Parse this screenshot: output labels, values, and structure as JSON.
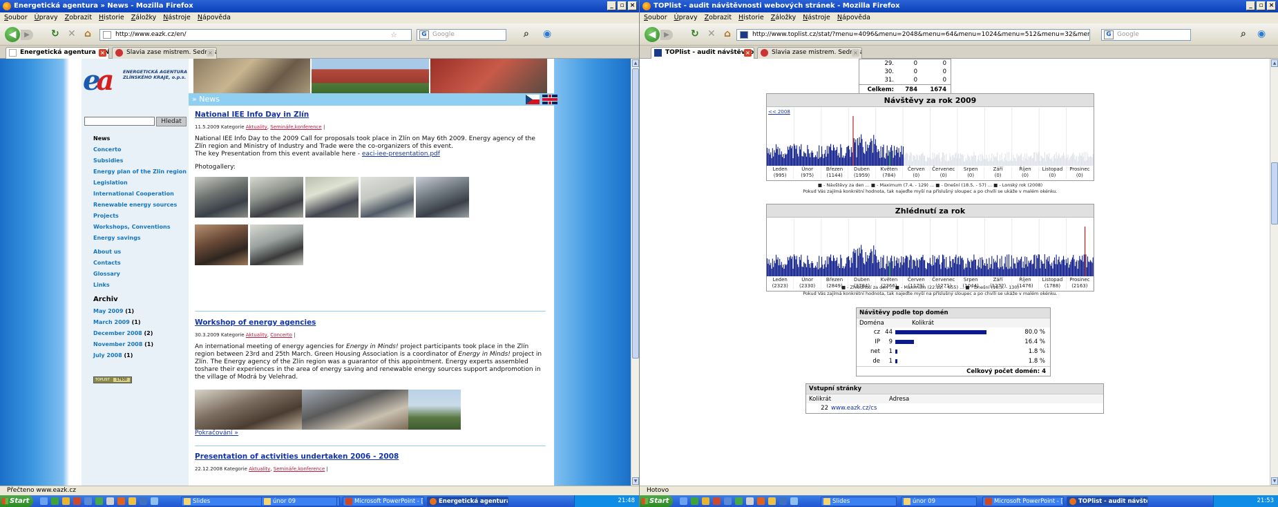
{
  "left_window": {
    "title": "Energetická agentura » News - Mozilla Firefox",
    "menu": [
      "Soubor",
      "Úpravy",
      "Zobrazit",
      "Historie",
      "Záložky",
      "Nástroje",
      "Nápověda"
    ],
    "url": "http://www.eazk.cz/en/",
    "search_placeholder": "Google",
    "tabs": [
      {
        "label": "Energetická agentura » News",
        "active": true
      },
      {
        "label": "Slavia zase mistrem. Sedmnáctý titul sl...",
        "active": false
      }
    ],
    "status": "Přečteno www.eazk.cz",
    "page": {
      "logo_text_1": "ENERGETICKÁ AGENTURA",
      "logo_text_2": "ZLÍNSKÉHO KRAJE, o.p.s.",
      "search_button": "Hledat",
      "news_bar": "» News",
      "nav": [
        "News",
        "Concerto",
        "Subsidies",
        "Energy plan of the Zlin region",
        "Legislation",
        "International Cooperation",
        "Renewable energy sources",
        "Projects",
        "Workshops, Conventions",
        "Energy savings"
      ],
      "nav2": [
        "About us",
        "Contacts",
        "Glossary",
        "Links"
      ],
      "archive_heading": "Archiv",
      "archive": [
        {
          "label": "May 2009",
          "count": "(1)"
        },
        {
          "label": "March 2009",
          "count": "(1)"
        },
        {
          "label": "December 2008",
          "count": "(2)"
        },
        {
          "label": "November 2008",
          "count": "(1)"
        },
        {
          "label": "July 2008",
          "count": "(1)"
        }
      ],
      "toplist_label": "TOPLIST",
      "toplist_count": "17930",
      "articles": [
        {
          "title": "National IEE Info Day in Zlín",
          "date_cat": "11.5.2009 Kategorie",
          "cats": [
            "Aktuality",
            "Semináře,konference"
          ],
          "body1": "National IEE Info Day to the 2009 Call for proposals took place in Zlín on May 6th 2009. Energy agency of the Zlín region and Ministry of Industry and Trade were the co-organizers of this event.",
          "body2": "The key Presentation from this event available here - ",
          "link": "eaci-iee-presentation.pdf",
          "gallery": "Photogallery:"
        },
        {
          "title": "Workshop of energy agencies",
          "date_cat": "30.3.2009 Kategorie",
          "cats": [
            "Aktuality",
            "Concerto"
          ],
          "body_pre": "An international meeting of energy agencies for ",
          "body_em1": "Energy in Minds!",
          "body_mid": " project participants took place in the Zlín region between 23rd and 25th March. Green Housing Association is a coordinator of ",
          "body_em2": "Energy in Minds!",
          "body_post": " project in Zlín. The Energy agency of the Zlín region was a guarantor of this appointment. Energy experts assembled toshare their experiences in the area of energy saving and renewable energy sources support andpromotion in the village of Modrá by Velehrad.",
          "more": "Pokračování »"
        },
        {
          "title": "Presentation of activities undertaken 2006 - 2008",
          "date_cat": "22.12.2008 Kategorie",
          "cats": [
            "Aktuality",
            "Semináře,konference"
          ]
        }
      ]
    },
    "taskbar": {
      "start": "Start",
      "items": [
        "Slides",
        "únor 09",
        "Microsoft PowerPoint - [...",
        "Energetická agentura..."
      ],
      "clock": "21:48"
    }
  },
  "right_window": {
    "title": "TOPlist - audit návštěvnosti webových stránek - Mozilla Firefox",
    "menu": [
      "Soubor",
      "Úpravy",
      "Zobrazit",
      "Historie",
      "Záložky",
      "Nástroje",
      "Nápověda"
    ],
    "url": "http://www.toplist.cz/stat/?menu=4096&menu=2048&menu=64&menu=1024&menu=512&menu=32&menu=256&menu=4&menu=128&menu=8&",
    "search_placeholder": "Google",
    "tabs": [
      {
        "label": "TOPlist - audit návštěvnosti web...",
        "active": true
      },
      {
        "label": "Slavia zase mistrem. Sedmnáctý titul sl...",
        "active": false
      }
    ],
    "status": "Hotovo",
    "page": {
      "day_rows": [
        {
          "d": "29.",
          "a": "0",
          "b": "0"
        },
        {
          "d": "30.",
          "a": "0",
          "b": "0"
        },
        {
          "d": "31.",
          "a": "0",
          "b": "0"
        }
      ],
      "total": {
        "label": "Celkem:",
        "a": "784",
        "b": "1674"
      },
      "chart1": {
        "title": "Návštěvy za rok 2009",
        "prev": "<< 2008",
        "months": [
          "Leden",
          "Únor",
          "Březen",
          "Duben",
          "Květen",
          "Červen",
          "Červenec",
          "Srpen",
          "Září",
          "Říjen",
          "Listopad",
          "Prosinec"
        ],
        "totals": [
          "(995)",
          "(975)",
          "(1144)",
          "(1959)",
          "(784)",
          "(0)",
          "(0)",
          "(0)",
          "(0)",
          "(0)",
          "(0)",
          "(0)"
        ],
        "legend": "■ - Návštěvy za den ... ■ - Maximum (7.4. - 129) ... ■ - Dnešní (18.5. - 57) ... ■ - Lonský rok (2008)",
        "hint": "Pokud Vás zajímá konkrétní hodnota, tak najeďte myší na příslušný sloupec a po chvíli se ukáže v malém okénku."
      },
      "chart2": {
        "title": "Zhlédnutí za rok",
        "months": [
          "Leden",
          "Únor",
          "Březen",
          "Duben",
          "Květen",
          "Červen",
          "Červenec",
          "Srpen",
          "Září",
          "Říjen",
          "Listopad",
          "Prosinec"
        ],
        "totals": [
          "(2323)",
          "(2330)",
          "(2849)",
          "(3784)",
          "(2366)",
          "(1179)",
          "(1271)",
          "(1044)",
          "(1272)",
          "(1476)",
          "(1788)",
          "(2163)"
        ],
        "legend": "■ - Zhlédnutí za den ... ■ - Maximum (22.12. - 655) ... ■ - Dnešní (18.5. - 130)",
        "hint": "Pokud Vás zajímá konkrétní hodnota, tak najeďte myší na příslušný sloupec a po chvíli se ukáže v malém okénku."
      },
      "domains": {
        "title": "Návštěvy podle top domén",
        "col1": "Doména",
        "col2": "Kolikrát",
        "rows": [
          {
            "name": "cz",
            "count": "44",
            "pct": "80.0 %",
            "frac": 0.8
          },
          {
            "name": "IP",
            "count": "9",
            "pct": "16.4 %",
            "frac": 0.164
          },
          {
            "name": "net",
            "count": "1",
            "pct": "1.8 %",
            "frac": 0.018
          },
          {
            "name": "de",
            "count": "1",
            "pct": "1.8 %",
            "frac": 0.018
          }
        ],
        "total": "Celkový počet domén: 4"
      },
      "entry": {
        "title": "Vstupní stránky",
        "col1": "Kolikrát",
        "col2": "Adresa",
        "rows": [
          {
            "count": "22",
            "url": "www.eazk.cz/cs"
          }
        ]
      }
    },
    "taskbar": {
      "start": "Start",
      "items": [
        "Slides",
        "únor 09",
        "Microsoft PowerPoint - [...",
        "TOPlist - audit návště..."
      ],
      "clock": "21:53"
    }
  }
}
